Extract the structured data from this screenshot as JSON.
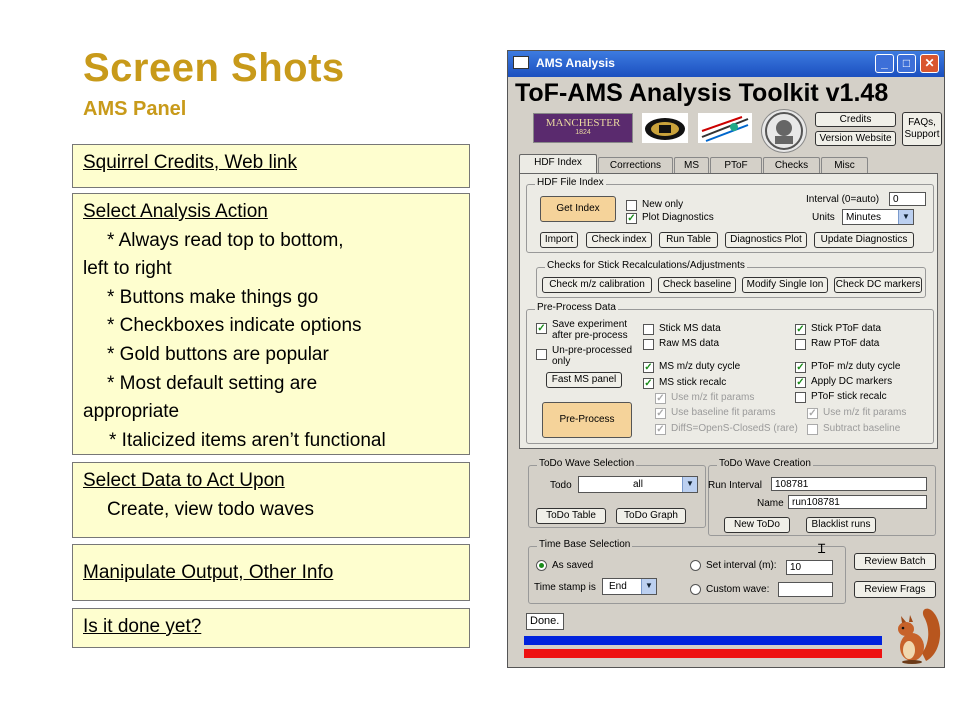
{
  "slide": {
    "title": "Screen Shots",
    "subtitle": "AMS Panel",
    "notes": [
      {
        "heading": "Squirrel Credits, Web link"
      },
      {
        "heading": "Select Analysis Action",
        "lines": [
          "* Always read top to bottom,",
          "left to right",
          "* Buttons make things go",
          "* Checkboxes indicate options",
          "* Gold buttons are popular",
          "* Most default setting are",
          "appropriate",
          "* Italicized items aren’t functional"
        ]
      },
      {
        "heading": "Select Data to Act Upon",
        "lines": [
          "Create, view todo waves"
        ]
      },
      {
        "heading": "Manipulate Output, Other Info"
      },
      {
        "heading": "Is it done yet?"
      }
    ]
  },
  "window": {
    "title": "AMS Analysis",
    "app_title": "ToF-AMS Analysis Toolkit v1.48",
    "buttons": {
      "credits": "Credits",
      "version_website": "Version Website",
      "faqs": "FAQs, Support"
    },
    "logos": {
      "manchester": "MANCHESTER",
      "manchester_year": "1824"
    },
    "tabs": [
      "HDF Index",
      "Corrections",
      "MS",
      "PToF",
      "Checks",
      "Misc"
    ],
    "active_tab": "HDF Index",
    "hdf_file_index": {
      "title": "HDF File Index",
      "get_index": "Get Index",
      "new_only": "New only",
      "plot_diagnostics": "Plot Diagnostics",
      "interval_label": "Interval (0=auto)",
      "interval_value": "0",
      "units_label": "Units",
      "units_value": "Minutes",
      "buttons": [
        "Import",
        "Check index",
        "Run Table",
        "Diagnostics Plot",
        "Update Diagnostics"
      ]
    },
    "checks": {
      "title": "Checks for Stick Recalculations/Adjustments",
      "buttons": [
        "Check m/z calibration",
        "Check baseline",
        "Modify Single Ion",
        "Check DC markers"
      ]
    },
    "preprocess": {
      "title": "Pre-Process Data",
      "save_experiment": "Save experiment after pre-process",
      "unpreprocessed": "Un-pre-processed only",
      "fast_ms_panel": "Fast MS panel",
      "preprocess_btn": "Pre-Process",
      "left_col": [
        {
          "label": "Stick MS data",
          "checked": false,
          "disabled": false
        },
        {
          "label": "Raw MS data",
          "checked": false,
          "disabled": false
        },
        {
          "label": "MS m/z duty cycle",
          "checked": true,
          "disabled": false
        },
        {
          "label": "MS stick recalc",
          "checked": true,
          "disabled": false
        },
        {
          "label": "Use m/z fit params",
          "checked": true,
          "disabled": true
        },
        {
          "label": "Use baseline fit params",
          "checked": true,
          "disabled": true
        },
        {
          "label": "DiffS=OpenS-ClosedS (rare)",
          "checked": true,
          "disabled": true
        }
      ],
      "right_col": [
        {
          "label": "Stick PToF data",
          "checked": true,
          "disabled": false
        },
        {
          "label": "Raw PToF data",
          "checked": false,
          "disabled": false
        },
        {
          "label": "PToF m/z duty cycle",
          "checked": true,
          "disabled": false
        },
        {
          "label": "Apply DC markers",
          "checked": true,
          "disabled": false
        },
        {
          "label": "PToF stick recalc",
          "checked": false,
          "disabled": false
        },
        {
          "label": "Use m/z fit params",
          "checked": true,
          "disabled": true
        },
        {
          "label": "Subtract baseline",
          "checked": false,
          "disabled": true
        }
      ]
    },
    "todo_selection": {
      "title": "ToDo Wave Selection",
      "todo_label": "Todo",
      "todo_value": "all",
      "buttons": [
        "ToDo Table",
        "ToDo Graph"
      ]
    },
    "todo_creation": {
      "title": "ToDo Wave Creation",
      "run_interval_label": "Run Interval",
      "run_interval_value": "108781",
      "name_label": "Name",
      "name_value": "run108781",
      "buttons": [
        "New ToDo",
        "Blacklist runs"
      ]
    },
    "time_base": {
      "title": "Time Base Selection",
      "as_saved": "As saved",
      "time_stamp_label": "Time stamp is",
      "time_stamp_value": "End",
      "set_interval": "Set interval (m):",
      "set_interval_value": "10",
      "custom_wave": "Custom wave:",
      "custom_wave_value": ""
    },
    "review_batch": "Review Batch",
    "review_frags": "Review Frags",
    "status": "Done.",
    "colors": {
      "bar_top": "#0022dd",
      "bar_bottom": "#ee1111",
      "gold": "#f5d39a",
      "title": "#c89a1a"
    }
  }
}
